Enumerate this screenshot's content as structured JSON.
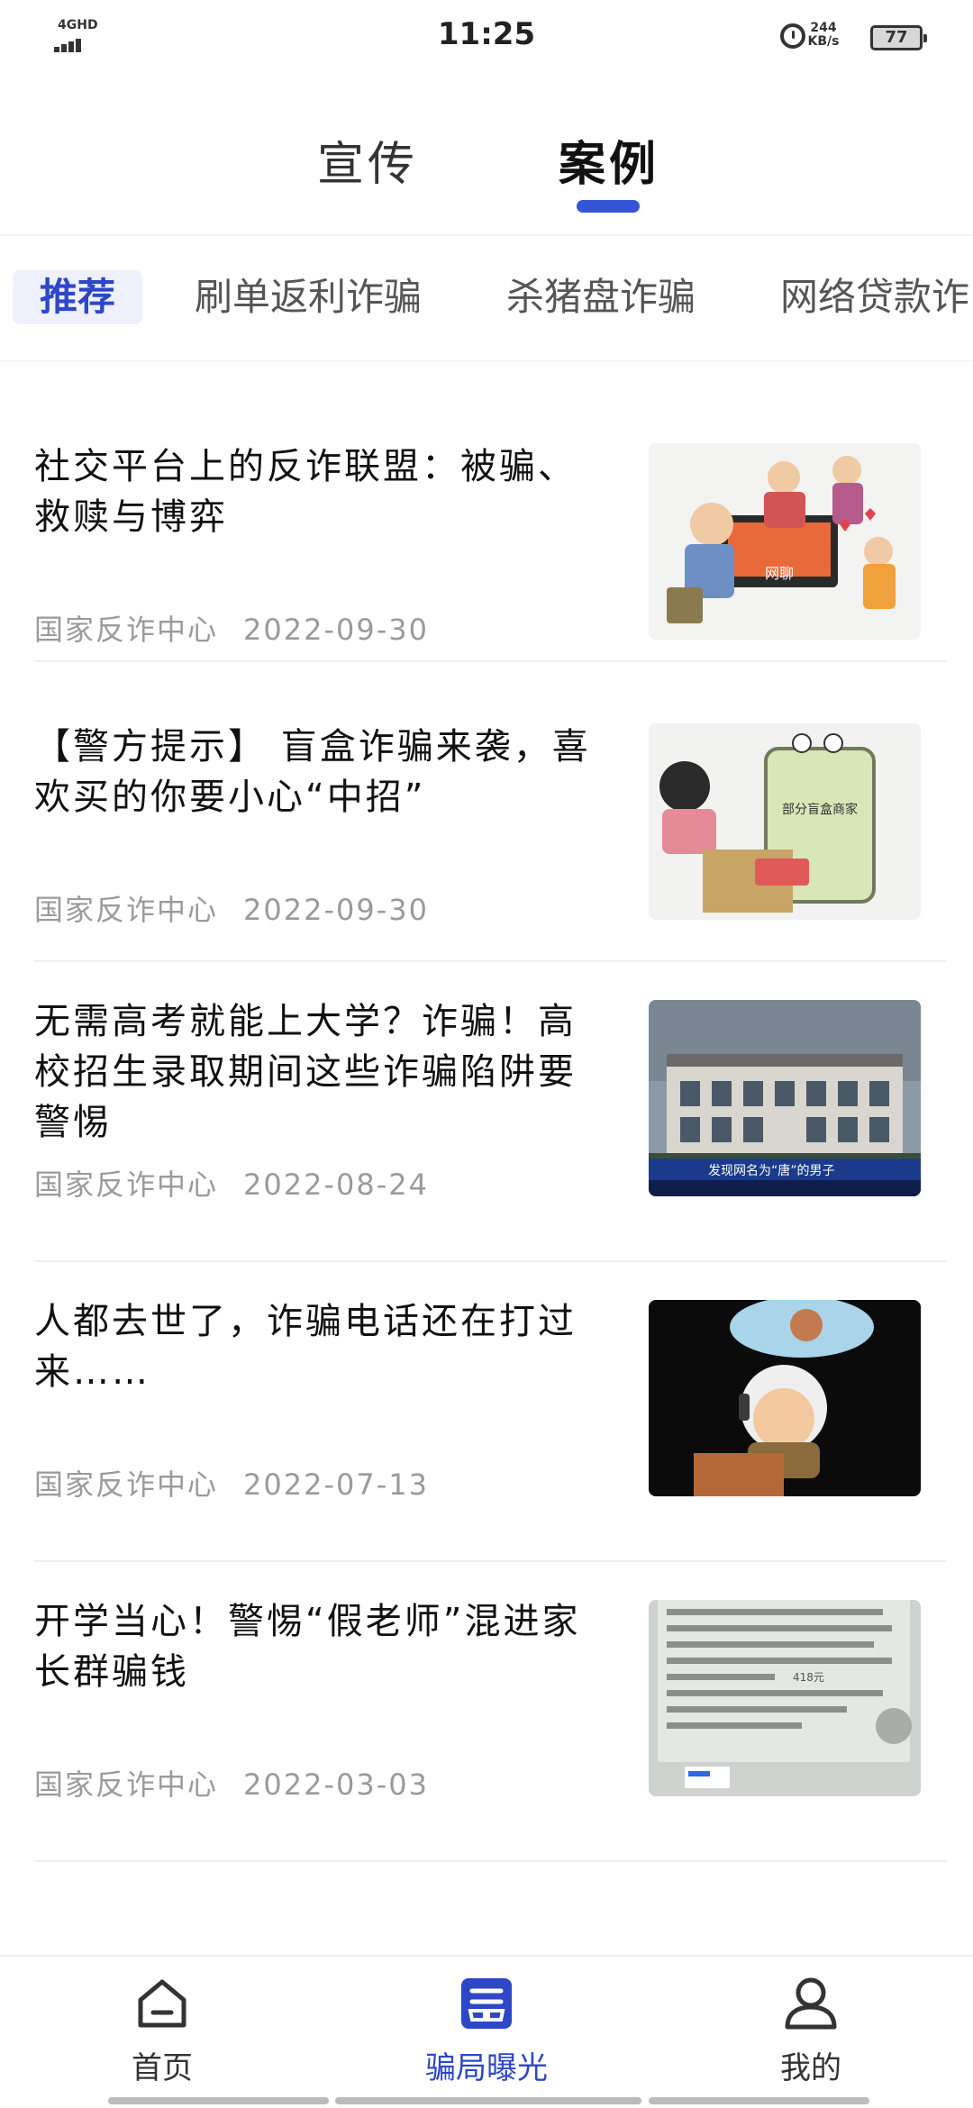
{
  "status_bar": {
    "network": "4GHD",
    "time": "11:25",
    "speed_value": "244",
    "speed_unit": "KB/s",
    "battery": "77"
  },
  "top_tabs": [
    {
      "label": "宣传",
      "active": false
    },
    {
      "label": "案例",
      "active": true
    }
  ],
  "categories": [
    {
      "label": "推荐",
      "active": true
    },
    {
      "label": "刷单返利诈骗",
      "active": false
    },
    {
      "label": "杀猪盘诈骗",
      "active": false
    },
    {
      "label": "网络贷款诈",
      "active": false
    }
  ],
  "articles": [
    {
      "title": "社交平台上的反诈联盟：被骗、救赎与博弈",
      "source": "国家反诈中心",
      "date": "2022-09-30",
      "thumb_text": "网聊"
    },
    {
      "title": "【警方提示】 盲盒诈骗来袭，喜欢买的你要小心“中招”",
      "source": "国家反诈中心",
      "date": "2022-09-30",
      "thumb_text": "部分盲盒商家"
    },
    {
      "title": "无需高考就能上大学？诈骗！高校招生录取期间这些诈骗陷阱要警惕",
      "source": "国家反诈中心",
      "date": "2022-08-24",
      "thumb_text": "发现网名为“唐”的男子"
    },
    {
      "title": "人都去世了，诈骗电话还在打过来……",
      "source": "国家反诈中心",
      "date": "2022-07-13",
      "thumb_text": ""
    },
    {
      "title": "开学当心！警惕“假老师”混进家长群骗钱",
      "source": "国家反诈中心",
      "date": "2022-03-03",
      "thumb_text": "418元"
    }
  ],
  "bottom_nav": [
    {
      "label": "首页",
      "icon": "home-icon",
      "active": false
    },
    {
      "label": "骗局曝光",
      "icon": "expose-icon",
      "active": true
    },
    {
      "label": "我的",
      "icon": "user-icon",
      "active": false
    }
  ],
  "colors": {
    "accent": "#2d47c6",
    "indicator": "#3555d8",
    "meta_text": "#9a9a9a"
  }
}
